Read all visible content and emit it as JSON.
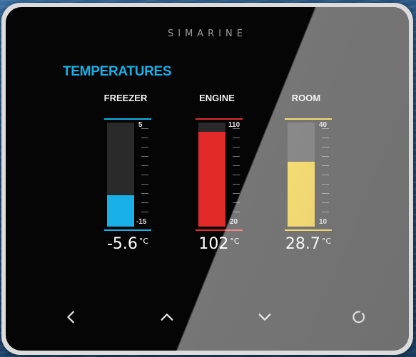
{
  "brand": "SIMARINE",
  "section_title": "TEMPERATURES",
  "gauges": [
    {
      "label": "FREEZER",
      "max": "5",
      "min": "-15",
      "value": "-5.6",
      "unit": "°C",
      "fill_fraction": 0.3,
      "color": "#19b0e8"
    },
    {
      "label": "ENGINE",
      "max": "110",
      "min": "20",
      "value": "102",
      "unit": "°C",
      "fill_fraction": 0.91,
      "color": "#e32a2a"
    },
    {
      "label": "ROOM",
      "max": "40",
      "min": "10",
      "value": "28.7",
      "unit": "°C",
      "fill_fraction": 0.62,
      "color": "#f4c400"
    }
  ],
  "nav": [
    "chevron-left-icon",
    "chevron-up-icon",
    "chevron-down-icon",
    "circle-icon"
  ],
  "colors": {
    "accent": "#19b0e8",
    "nav_icon": "#e6e6e6"
  }
}
